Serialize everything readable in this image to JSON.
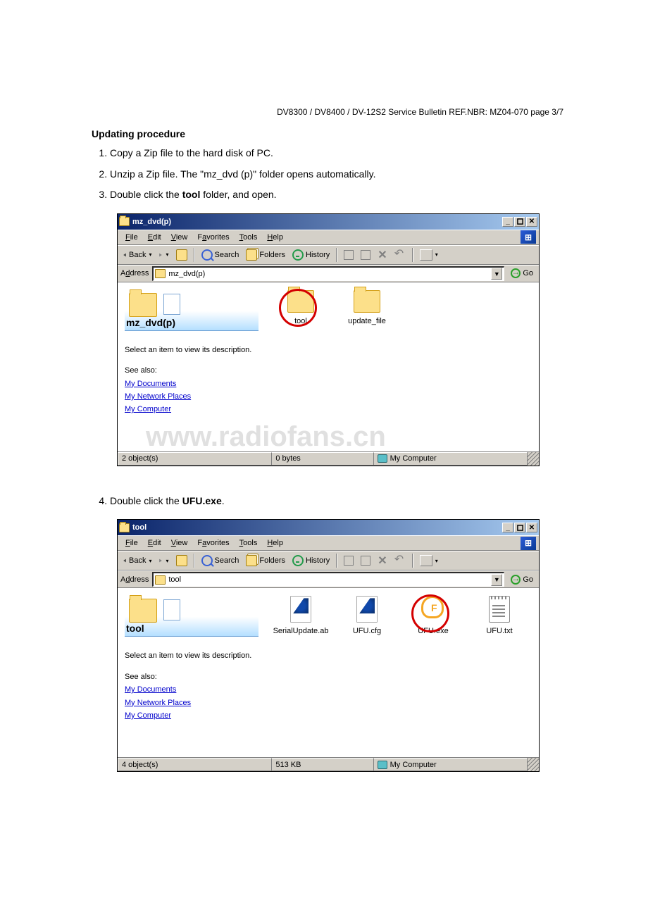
{
  "header": "DV8300 / DV8400 / DV-12S2 Service Bulletin REF.NBR: MZ04-070    page 3/7",
  "heading": "Updating procedure",
  "steps": {
    "s1": "Copy a Zip file to the hard disk of PC.",
    "s2": "Unzip a Zip file. The \"mz_dvd (p)\" folder opens automatically.",
    "s3_pre": "Double click the ",
    "s3_bold": "tool",
    "s3_post": " folder, and open.",
    "s4_pre": "Double click the ",
    "s4_bold": "UFU.exe",
    "s4_post": "."
  },
  "watermark": "www.radiofans.cn",
  "win1": {
    "title": "mz_dvd(p)",
    "menu": {
      "file": "File",
      "edit": "Edit",
      "view": "View",
      "fav": "Favorites",
      "tools": "Tools",
      "help": "Help"
    },
    "tb": {
      "back": "Back",
      "search": "Search",
      "folders": "Folders",
      "history": "History"
    },
    "addr_label": "Address",
    "addr_value": "mz_dvd(p)",
    "go": "Go",
    "panel": {
      "title": "mz_dvd(p)",
      "desc": "Select an item to view its description.",
      "see": "See also:",
      "l1": "My Documents",
      "l2": "My Network Places",
      "l3": "My Computer"
    },
    "items": [
      "tool",
      "update_file"
    ],
    "status": {
      "count": "2 object(s)",
      "size": "0 bytes",
      "loc": "My Computer"
    }
  },
  "win2": {
    "title": "tool",
    "menu": {
      "file": "File",
      "edit": "Edit",
      "view": "View",
      "fav": "Favorites",
      "tools": "Tools",
      "help": "Help"
    },
    "tb": {
      "back": "Back",
      "search": "Search",
      "folders": "Folders",
      "history": "History"
    },
    "addr_label": "Address",
    "addr_value": "tool",
    "go": "Go",
    "panel": {
      "title": "tool",
      "desc": "Select an item to view its description.",
      "see": "See also:",
      "l1": "My Documents",
      "l2": "My Network Places",
      "l3": "My Computer"
    },
    "items": [
      "SerialUpdate.ab",
      "UFU.cfg",
      "UFU.exe",
      "UFU.txt"
    ],
    "status": {
      "count": "4 object(s)",
      "size": "513 KB",
      "loc": "My Computer"
    }
  }
}
